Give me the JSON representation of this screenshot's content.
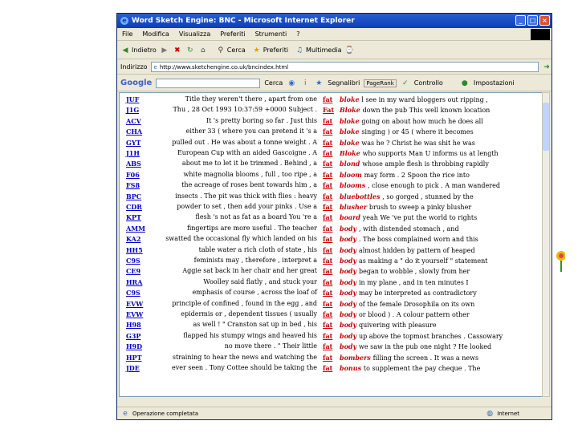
{
  "window": {
    "title": "Word Sketch Engine: BNC - Microsoft Internet Explorer"
  },
  "menu": [
    "File",
    "Modifica",
    "Visualizza",
    "Preferiti",
    "Strumenti",
    "?"
  ],
  "toolbar": {
    "back": "Indietro",
    "search": "Cerca",
    "favorites": "Preferiti",
    "multimedia": "Multimedia"
  },
  "address": {
    "label": "Indirizzo",
    "url": "http://www.sketchengine.co.uk/bncindex.html"
  },
  "google": {
    "logo": "Google",
    "search_btn": "Cerca",
    "bookmarks": "Segnalibri",
    "pagerank": "PageRank",
    "spell": "Controllo",
    "settings": "Impostazioni"
  },
  "rows": [
    {
      "code": "JUF",
      "left": "Title they weren't there , apart from one",
      "kw": "fat",
      "col": "bloke",
      "right": "l see in my ward bloggers out ripping ,"
    },
    {
      "code": "J1G",
      "left": "Thu , 28 Oct 1993 10:37:59 +0000 Subject .",
      "kw": "Fat",
      "col": "Bloke",
      "right": "down the pub This well known location"
    },
    {
      "code": "ACV",
      "left": "It 's pretty boring so far . Just this",
      "kw": "fat",
      "col": "bloke",
      "right": "going on about how much he does all"
    },
    {
      "code": "CHA",
      "left": "either 33 ( where you can pretend it 's a",
      "kw": "fat",
      "col": "bloke",
      "right": "singing ) or 45 ( where it becomes"
    },
    {
      "code": "GYT",
      "left": "pulled out . He was about a tonne weight . A",
      "kw": "fat",
      "col": "bloke",
      "right": "was he ? Christ he was shit he was"
    },
    {
      "code": "J1H",
      "left": "European Cup with an aided Gascoigne . A",
      "kw": "fat",
      "col": "Bloke",
      "right": "who supports Man U informs us at length"
    },
    {
      "code": "ABS",
      "left": "about me to let it be trimmed . Behind , a",
      "kw": "fat",
      "col": "blond",
      "right": "whose ample flesh is throbbing rapidly"
    },
    {
      "code": "F06",
      "left": "white magnolia blooms , full , too ripe , a",
      "kw": "fat",
      "col": "bloom",
      "right": "may form . 2 Spoon the rice into"
    },
    {
      "code": "FS8",
      "left": "the acreage of roses bent towards him , a",
      "kw": "fat",
      "col": "blooms",
      "right": ", close enough to pick . A man wandered"
    },
    {
      "code": "BPC",
      "left": "insects . The pit was thick with flies : heavy",
      "kw": "fat",
      "col": "bluebottles",
      "right": ", so gorged , stunned by the"
    },
    {
      "code": "CDR",
      "left": "powder to set , then add your pinks . Use a",
      "kw": "fat",
      "col": "blusher",
      "right": "brush to sweep a pinky blusher"
    },
    {
      "code": "KPT",
      "left": "flesh 's not as fat as a board You 're a",
      "kw": "fat",
      "col": "board",
      "right": "yeah We 've put the world to rights"
    },
    {
      "code": "AMM",
      "left": "fingertips are more useful . The teacher",
      "kw": "fat",
      "col": "body",
      "right": ", with distended stomach , and"
    },
    {
      "code": "KA2",
      "left": "swatted the occasional fly which landed on his",
      "kw": "fat",
      "col": "body",
      "right": ". The boss complained worn and this"
    },
    {
      "code": "HH5",
      "left": "table water a rich cloth of state , his",
      "kw": "fat",
      "col": "body",
      "right": "almost hidden by pattern of heaped"
    },
    {
      "code": "C9S",
      "left": "feminists may , therefore , interpret a",
      "kw": "fat",
      "col": "body",
      "right": "as making a \" do it yourself \" statement"
    },
    {
      "code": "CE9",
      "left": "Aggie sat back in her chair and her great",
      "kw": "fat",
      "col": "body",
      "right": "began to wobble , slowly from her"
    },
    {
      "code": "HRA",
      "left": "Woolley said flatly , and stuck your",
      "kw": "fat",
      "col": "body",
      "right": "in my plane , and in ten minutes I"
    },
    {
      "code": "C9S",
      "left": "emphasis of course , across the loaf of",
      "kw": "fat",
      "col": "body",
      "right": "may be interpreted as contradictory"
    },
    {
      "code": "EVW",
      "left": "principle of confined , found in the egg , and",
      "kw": "fat",
      "col": "body",
      "right": "of the female Drosophila on its own"
    },
    {
      "code": "EVW",
      "left": "epidermis or , dependent tissues ( usually",
      "kw": "fat",
      "col": "body",
      "right": "or blood ) . A colour pattern other"
    },
    {
      "code": "H98",
      "left": "as well ! \" Cranston sat up in bed , his",
      "kw": "fat",
      "col": "body",
      "right": "quivering with pleasure"
    },
    {
      "code": "G3P",
      "left": "flapped his stumpy wings and heaved his",
      "kw": "fat",
      "col": "body",
      "right": "up above the topmost branches . Cassowary"
    },
    {
      "code": "H9D",
      "left": "no move there . \" Their little",
      "kw": "fat",
      "col": "body",
      "right": "we saw in the pub one night ? He looked"
    },
    {
      "code": "HPT",
      "left": "straining to hear the news and watching the",
      "kw": "fat",
      "col": "bombers",
      "right": "filling the screen . It was a news"
    },
    {
      "code": "JDE",
      "left": "ever seen . Tony Cottee should be taking the",
      "kw": "fat",
      "col": "bonus",
      "right": "to supplement the pay cheque . The"
    }
  ],
  "status": {
    "text": "Operazione completata",
    "zone": "Internet"
  }
}
